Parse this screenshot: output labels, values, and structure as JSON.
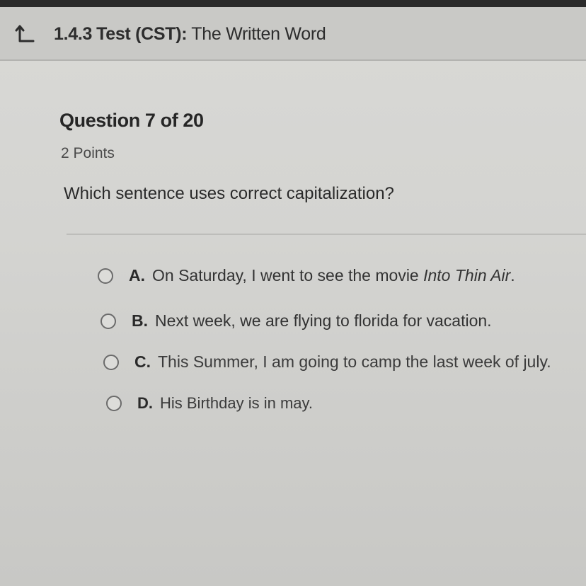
{
  "header": {
    "back_icon": "back-arrow-icon",
    "lesson_code": "1.4.3",
    "lesson_type": "Test (CST):",
    "lesson_name": "The Written Word"
  },
  "question": {
    "number_label": "Question 7 of 20",
    "points_label": "2 Points",
    "prompt": "Which sentence uses correct capitalization?"
  },
  "options": [
    {
      "letter": "A.",
      "text": "On Saturday, I went to see the movie ",
      "italic": "Into Thin Air",
      "suffix": "."
    },
    {
      "letter": "B.",
      "text": "Next week, we are flying to florida for vacation."
    },
    {
      "letter": "C.",
      "text": "This Summer, I am going to camp the last week of july."
    },
    {
      "letter": "D.",
      "text": "His Birthday is in may."
    }
  ]
}
